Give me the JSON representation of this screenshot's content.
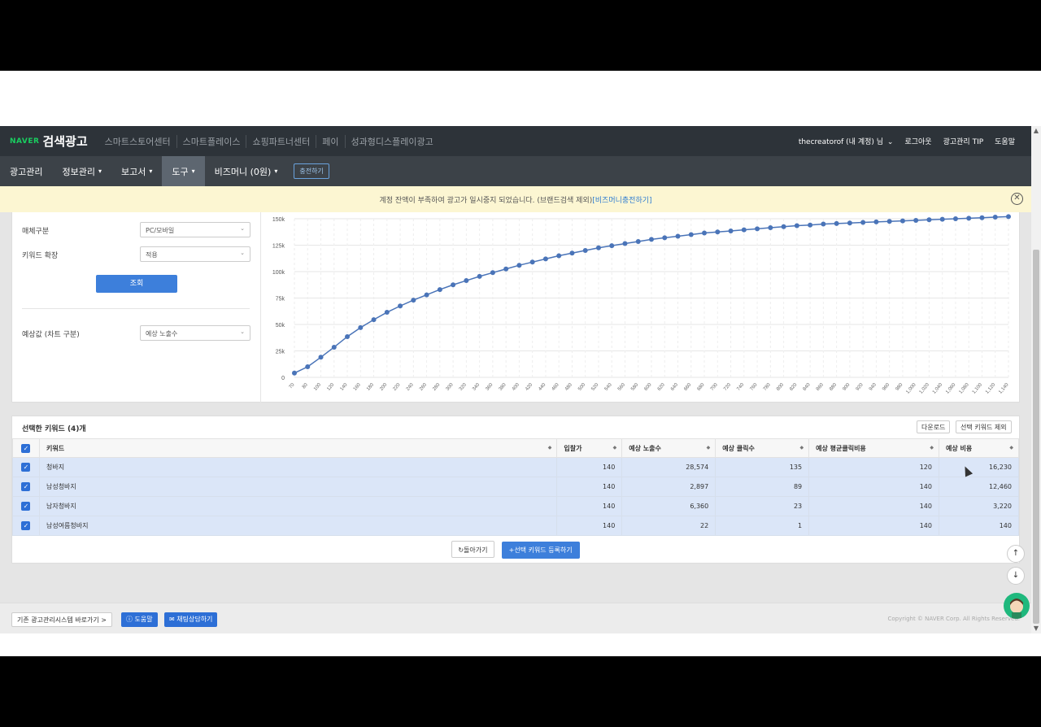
{
  "topnav": {
    "brand_small": "NAVER",
    "brand_title": "검색광고",
    "links": [
      "스마트스토어센터",
      "스마트플레이스",
      "쇼핑파트너센터",
      "페이",
      "성과형디스플레이광고"
    ],
    "account": "thecreatorof (내 계정) 님",
    "logout": "로그아웃",
    "tip": "광고관리 TIP",
    "help": "도움말"
  },
  "mainnav": {
    "items": [
      "광고관리",
      "정보관리",
      "보고서",
      "도구",
      "비즈머니 (0원)"
    ],
    "charge": "충전하기"
  },
  "alert": {
    "text": "계정 잔액이 부족하여 광고가 일시중지 되었습니다. (브랜드검색 제외)",
    "link": "[비즈머니충전하기]"
  },
  "form": {
    "media_label": "매체구분",
    "media_value": "PC/모바일",
    "expand_label": "키워드 확장",
    "expand_value": "적용",
    "query_button": "조회",
    "estimate_label": "예상값 (차트 구분)",
    "estimate_value": "예상 노출수"
  },
  "chart_data": {
    "type": "line",
    "x": [
      70,
      80,
      100,
      120,
      140,
      160,
      180,
      200,
      220,
      240,
      260,
      280,
      300,
      320,
      340,
      360,
      380,
      400,
      420,
      440,
      460,
      480,
      500,
      520,
      540,
      560,
      580,
      600,
      620,
      640,
      660,
      680,
      700,
      720,
      740,
      760,
      780,
      800,
      820,
      840,
      860,
      880,
      900,
      920,
      940,
      960,
      980,
      1000,
      1020,
      1040,
      1060,
      1080,
      1100,
      1120,
      1140
    ],
    "x_tick_labels": [
      "70",
      "80",
      "100",
      "120",
      "140",
      "160",
      "180",
      "200",
      "220",
      "240",
      "260",
      "280",
      "300",
      "320",
      "340",
      "360",
      "380",
      "400",
      "420",
      "440",
      "460",
      "480",
      "500",
      "520",
      "540",
      "560",
      "580",
      "600",
      "620",
      "640",
      "660",
      "680",
      "700",
      "720",
      "740",
      "760",
      "780",
      "800",
      "820",
      "840",
      "860",
      "880",
      "900",
      "920",
      "940",
      "960",
      "980",
      "1,000",
      "1,020",
      "1,040",
      "1,060",
      "1,080",
      "1,100",
      "1,120",
      "1,140"
    ],
    "y": [
      4000,
      10000,
      19000,
      28500,
      38500,
      47000,
      54500,
      61500,
      67500,
      73000,
      78000,
      83000,
      87500,
      91500,
      95500,
      99000,
      102500,
      106000,
      109000,
      112000,
      115000,
      117500,
      120000,
      122500,
      124500,
      126500,
      128500,
      130500,
      132000,
      133500,
      135000,
      136500,
      137500,
      138500,
      139500,
      140500,
      141500,
      142500,
      143500,
      144000,
      145000,
      145500,
      146000,
      146500,
      147000,
      147500,
      148000,
      148500,
      149000,
      149500,
      150000,
      150500,
      151000,
      151500,
      152000
    ],
    "y_ticks": [
      0,
      25000,
      50000,
      75000,
      100000,
      125000,
      150000
    ],
    "y_tick_labels": [
      "0",
      "25k",
      "50k",
      "75k",
      "100k",
      "125k",
      "150k"
    ],
    "ylim": [
      0,
      150000
    ],
    "color": "#4a74b8",
    "grid": true
  },
  "keywords": {
    "title": "선택한 키워드 (4)개",
    "download": "다운로드",
    "exclude": "선택 키워드 제외",
    "headers": [
      "키워드",
      "입찰가",
      "예상 노출수",
      "예상 클릭수",
      "예상 평균클릭비용",
      "예상 비용"
    ],
    "rows": [
      [
        "청바지",
        "140",
        "28,574",
        "135",
        "120",
        "16,230"
      ],
      [
        "남성청바지",
        "140",
        "2,897",
        "89",
        "140",
        "12,460"
      ],
      [
        "남자청바지",
        "140",
        "6,360",
        "23",
        "140",
        "3,220"
      ],
      [
        "남성여름청바지",
        "140",
        "22",
        "1",
        "140",
        "140"
      ]
    ],
    "back": "돌아가기",
    "register": "선택 키워드 등록하기"
  },
  "footer": {
    "legacy": "기존 광고관리시스템 바로가기 >",
    "help": "도움말",
    "chat": "채팅상담하기",
    "copyright": "Copyright © NAVER Corp. All Rights Reserved."
  }
}
